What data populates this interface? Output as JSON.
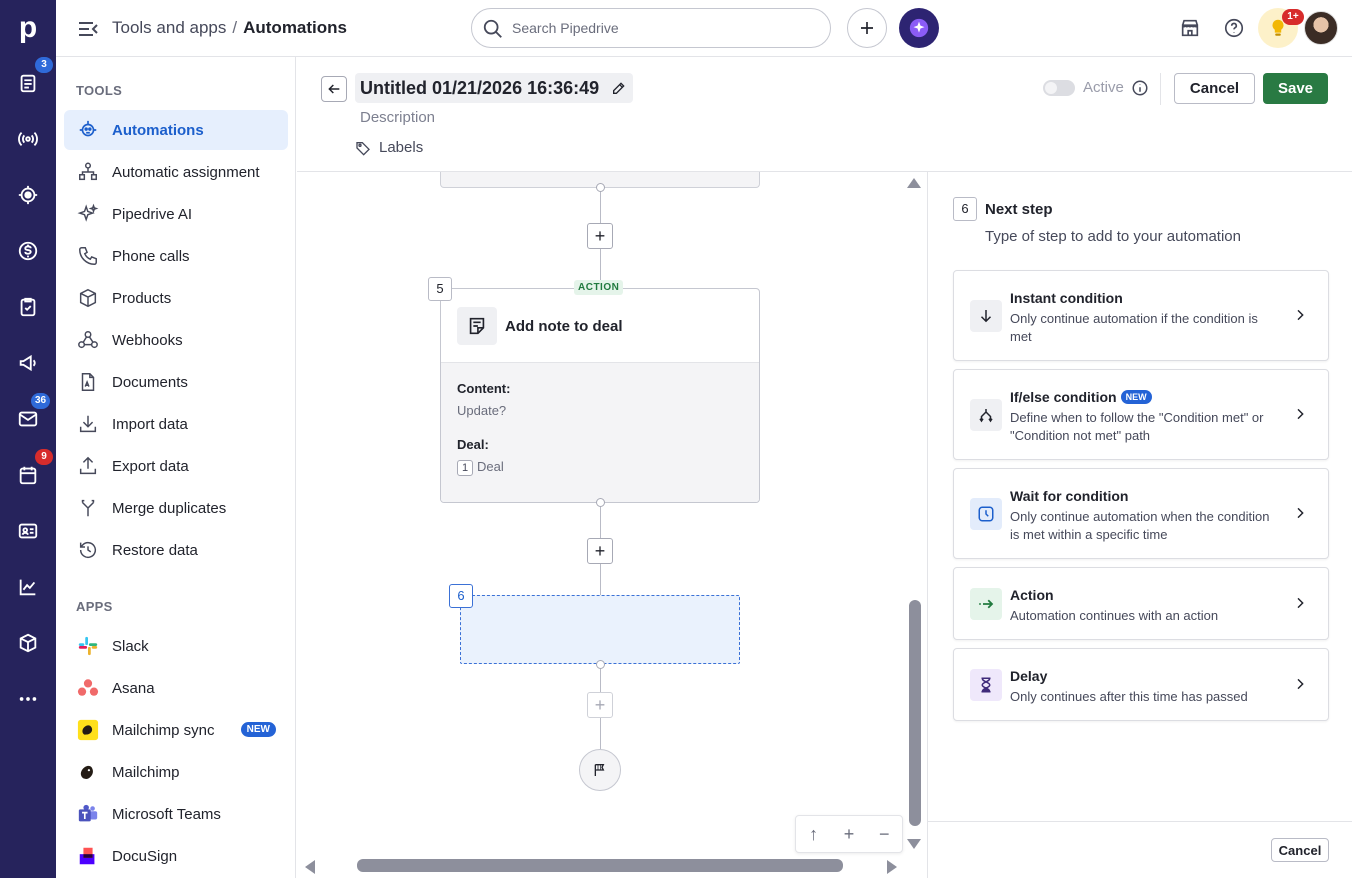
{
  "rail": {
    "badges": {
      "deals": "3",
      "mail": "36",
      "calendar": "9"
    }
  },
  "topbar": {
    "breadcrumb_parent": "Tools and apps",
    "breadcrumb_separator": "/",
    "breadcrumb_current": "Automations",
    "search_placeholder": "Search Pipedrive",
    "notification_badge": "1+"
  },
  "sidebar": {
    "tools_heading": "TOOLS",
    "tools": [
      {
        "label": "Automations",
        "icon": "automations-icon",
        "active": true
      },
      {
        "label": "Automatic assignment",
        "icon": "assignment-icon"
      },
      {
        "label": "Pipedrive AI",
        "icon": "sparkle-icon"
      },
      {
        "label": "Phone calls",
        "icon": "phone-icon"
      },
      {
        "label": "Products",
        "icon": "box-icon"
      },
      {
        "label": "Webhooks",
        "icon": "webhook-icon"
      },
      {
        "label": "Documents",
        "icon": "document-icon"
      },
      {
        "label": "Import data",
        "icon": "import-icon"
      },
      {
        "label": "Export data",
        "icon": "export-icon"
      },
      {
        "label": "Merge duplicates",
        "icon": "merge-icon"
      },
      {
        "label": "Restore data",
        "icon": "restore-icon"
      }
    ],
    "apps_heading": "APPS",
    "apps": [
      {
        "label": "Slack",
        "icon": "slack-icon"
      },
      {
        "label": "Asana",
        "icon": "asana-icon"
      },
      {
        "label": "Mailchimp sync",
        "icon": "mailchimp-icon",
        "badge": "NEW"
      },
      {
        "label": "Mailchimp",
        "icon": "mailchimp-icon"
      },
      {
        "label": "Microsoft Teams",
        "icon": "teams-icon"
      },
      {
        "label": "DocuSign",
        "icon": "docusign-icon"
      }
    ]
  },
  "header": {
    "title": "Untitled 01/21/2026 16:36:49",
    "description_placeholder": "Description",
    "labels": "Labels",
    "active_label": "Active",
    "active": false,
    "cancel": "Cancel",
    "save": "Save"
  },
  "canvas": {
    "step5": {
      "number": "5",
      "tag": "ACTION",
      "title": "Add note to deal",
      "content_label": "Content:",
      "content_value": "Update?",
      "deal_label": "Deal:",
      "deal_step": "1",
      "deal_value": "Deal"
    },
    "step6_number": "6",
    "add_symbol": "+",
    "zoom": {
      "up": "↑",
      "in": "+",
      "out": "−"
    }
  },
  "panel": {
    "step_number": "6",
    "title": "Next step",
    "subtitle": "Type of step to add to your automation",
    "options": [
      {
        "title": "Instant condition",
        "desc": "Only continue automation if the condition is met",
        "icon": "arrow-down-icon"
      },
      {
        "title": "If/else condition",
        "badge": "NEW",
        "desc": "Define when to follow the \"Condition met\" or \"Condition not met\" path",
        "icon": "branch-icon"
      },
      {
        "title": "Wait for condition",
        "desc": "Only continue automation when the condition is met within a specific time",
        "icon": "clock-icon"
      },
      {
        "title": "Action",
        "desc": "Automation continues with an action",
        "icon": "action-arrow-icon"
      },
      {
        "title": "Delay",
        "desc": "Only continues after this time has passed",
        "icon": "hourglass-icon"
      }
    ],
    "cancel": "Cancel"
  },
  "colors": {
    "rail": "#26235c",
    "accent": "#1c5fcc",
    "save": "#297a43",
    "new_badge": "#2463d6"
  }
}
